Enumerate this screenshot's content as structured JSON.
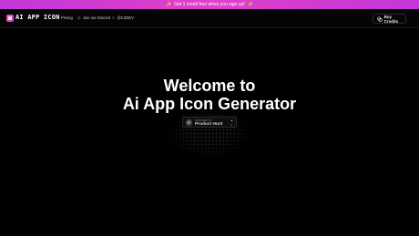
{
  "promo": {
    "text": "Get 1 credit free when you sign up!",
    "spark": "✨"
  },
  "nav": {
    "logo_text": "AI APP ICON",
    "links": [
      {
        "icon": "",
        "label": "Pricing"
      },
      {
        "icon": "◎",
        "label": "Join our Discord"
      },
      {
        "icon": "𝕏",
        "label": "@CZDEV"
      }
    ],
    "buy_label": "Buy Credits",
    "buy_icon": "coins-icon"
  },
  "hero": {
    "line1": "Welcome to",
    "line2": "Ai App Icon Generator"
  },
  "product_hunt": {
    "badge": "P",
    "small": "FEATURED ON",
    "label": "Product Hunt",
    "arrow": "▲",
    "votes": "1"
  },
  "colors": {
    "accent": "#c238d8",
    "background": "#000000"
  }
}
